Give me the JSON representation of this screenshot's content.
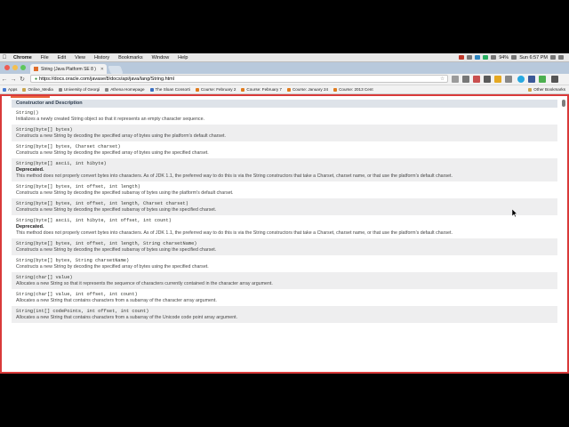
{
  "menubar": {
    "app": "Chrome",
    "items": [
      "File",
      "Edit",
      "View",
      "History",
      "Bookmarks",
      "Window",
      "Help"
    ],
    "battery": "94%",
    "clock": "Sun 6:57 PM"
  },
  "tab": {
    "title": "String (Java Platform SE 8 )"
  },
  "omnibox": {
    "url": "https://docs.oracle.com/javase/8/docs/api/java/lang/String.html"
  },
  "bookmarks": {
    "items": [
      "Apps",
      "Online_Media",
      "University of Georgi",
      "Athena Homepage",
      "The Sloan Consorti",
      "Course: February 2",
      "Course: February 7",
      "Course: January 24",
      "Course: 2013 Cent"
    ],
    "other": "Other Bookmarks"
  },
  "table": {
    "header": "Constructor and Description",
    "rows": [
      {
        "sig": "String()",
        "desc": "Initializes a newly created String object so that it represents an empty character sequence."
      },
      {
        "sig": "String(byte[] bytes)",
        "desc": "Constructs a new String by decoding the specified array of bytes using the platform's default charset."
      },
      {
        "sig": "String(byte[] bytes, Charset charset)",
        "desc": "Constructs a new String by decoding the specified array of bytes using the specified charset."
      },
      {
        "sig": "String(byte[] ascii, int hibyte)",
        "dep": "Deprecated.",
        "desc": "This method does not properly convert bytes into characters. As of JDK 1.1, the preferred way to do this is via the String constructors that take a Charset, charset name, or that use the platform's default charset."
      },
      {
        "sig": "String(byte[] bytes, int offset, int length)",
        "desc": "Constructs a new String by decoding the specified subarray of bytes using the platform's default charset."
      },
      {
        "sig": "String(byte[] bytes, int offset, int length, Charset charset)",
        "desc": "Constructs a new String by decoding the specified subarray of bytes using the specified charset."
      },
      {
        "sig": "String(byte[] ascii, int hibyte, int offset, int count)",
        "dep": "Deprecated.",
        "desc": "This method does not properly convert bytes into characters. As of JDK 1.1, the preferred way to do this is via the String constructors that take a Charset, charset name, or that use the platform's default charset."
      },
      {
        "sig": "String(byte[] bytes, int offset, int length, String charsetName)",
        "desc": "Constructs a new String by decoding the specified subarray of bytes using the specified charset."
      },
      {
        "sig": "String(byte[] bytes, String charsetName)",
        "desc": "Constructs a new String by decoding the specified array of bytes using the specified charset."
      },
      {
        "sig": "String(char[] value)",
        "desc": "Allocates a new String so that it represents the sequence of characters currently contained in the character array argument."
      },
      {
        "sig": "String(char[] value, int offset, int count)",
        "desc": "Allocates a new String that contains characters from a subarray of the character array argument."
      },
      {
        "sig": "String(int[] codePoints, int offset, int count)",
        "desc": "Allocates a new String that contains characters from a subarray of the Unicode code point array argument."
      }
    ]
  },
  "colors": {
    "highlight_border": "#d93a3a",
    "header_bg": "#dee3e9",
    "alt_row": "#eeeeef"
  }
}
